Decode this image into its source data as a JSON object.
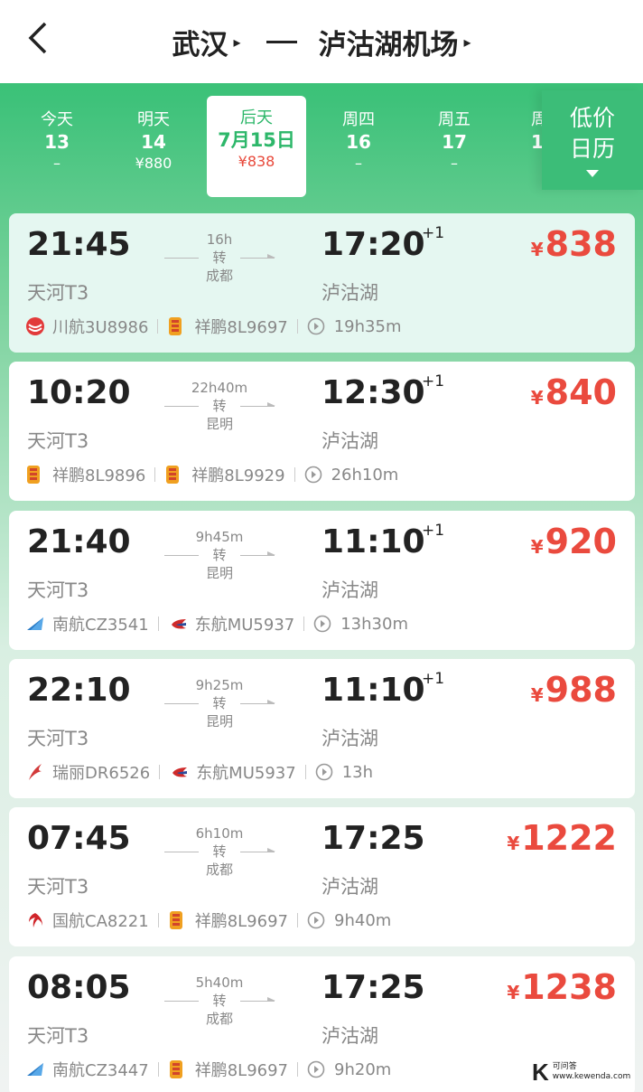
{
  "header": {
    "origin": "武汉",
    "destination": "泸沽湖机场",
    "caret": "▸"
  },
  "dates": [
    {
      "weekday": "今天",
      "date": "13",
      "price": "–"
    },
    {
      "weekday": "明天",
      "date": "14",
      "price": "¥880"
    },
    {
      "weekday": "后天",
      "date": "7月15日",
      "price": "¥838",
      "selected": true
    },
    {
      "weekday": "周四",
      "date": "16",
      "price": "–"
    },
    {
      "weekday": "周五",
      "date": "17",
      "price": "–"
    },
    {
      "weekday": "周",
      "date": "1",
      "price": ""
    }
  ],
  "calendar_button": {
    "line1": "低价",
    "line2": "日历"
  },
  "flights": [
    {
      "dep": "21:45",
      "arr": "17:20",
      "plus": "+1",
      "dep_airport": "天河T3",
      "arr_airport": "泸沽湖",
      "duration_leg": "16h",
      "transfer": "转",
      "via": "成都",
      "yen": "¥",
      "price": "838",
      "airline1": "川航3U8986",
      "airline1_icon": "sichuan-airlines-icon",
      "airline2": "祥鹏8L9697",
      "airline2_icon": "luckyair-icon",
      "total": "19h35m"
    },
    {
      "dep": "10:20",
      "arr": "12:30",
      "plus": "+1",
      "dep_airport": "天河T3",
      "arr_airport": "泸沽湖",
      "duration_leg": "22h40m",
      "transfer": "转",
      "via": "昆明",
      "yen": "¥",
      "price": "840",
      "airline1": "祥鹏8L9896",
      "airline1_icon": "luckyair-icon",
      "airline2": "祥鹏8L9929",
      "airline2_icon": "luckyair-icon",
      "total": "26h10m"
    },
    {
      "dep": "21:40",
      "arr": "11:10",
      "plus": "+1",
      "dep_airport": "天河T3",
      "arr_airport": "泸沽湖",
      "duration_leg": "9h45m",
      "transfer": "转",
      "via": "昆明",
      "yen": "¥",
      "price": "920",
      "airline1": "南航CZ3541",
      "airline1_icon": "china-southern-icon",
      "airline2": "东航MU5937",
      "airline2_icon": "china-eastern-icon",
      "total": "13h30m"
    },
    {
      "dep": "22:10",
      "arr": "11:10",
      "plus": "+1",
      "dep_airport": "天河T3",
      "arr_airport": "泸沽湖",
      "duration_leg": "9h25m",
      "transfer": "转",
      "via": "昆明",
      "yen": "¥",
      "price": "988",
      "airline1": "瑞丽DR6526",
      "airline1_icon": "ruili-airlines-icon",
      "airline2": "东航MU5937",
      "airline2_icon": "china-eastern-icon",
      "total": "13h"
    },
    {
      "dep": "07:45",
      "arr": "17:25",
      "plus": "",
      "dep_airport": "天河T3",
      "arr_airport": "泸沽湖",
      "duration_leg": "6h10m",
      "transfer": "转",
      "via": "成都",
      "yen": "¥",
      "price": "1222",
      "airline1": "国航CA8221",
      "airline1_icon": "air-china-icon",
      "airline2": "祥鹏8L9697",
      "airline2_icon": "luckyair-icon",
      "total": "9h40m"
    },
    {
      "dep": "08:05",
      "arr": "17:25",
      "plus": "",
      "dep_airport": "天河T3",
      "arr_airport": "泸沽湖",
      "duration_leg": "5h40m",
      "transfer": "转",
      "via": "成都",
      "yen": "¥",
      "price": "1238",
      "airline1": "南航CZ3447",
      "airline1_icon": "china-southern-icon",
      "airline2": "祥鹏8L9697",
      "airline2_icon": "luckyair-icon",
      "total": "9h20m"
    }
  ],
  "watermark": {
    "brand": "K",
    "text1": "可问答",
    "text2": "www.kewenda.com"
  },
  "colors": {
    "accent": "#2db76a",
    "price": "#ea4a3e",
    "highlight_card": "#e5f7f1"
  }
}
